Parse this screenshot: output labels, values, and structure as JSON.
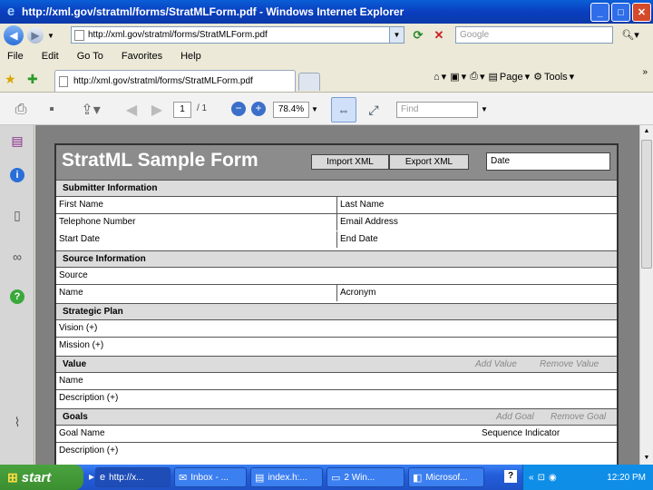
{
  "window": {
    "title": "http://xml.gov/stratml/forms/StratMLForm.pdf - Windows Internet Explorer",
    "minimize": "_",
    "maximize": "□",
    "close": "✕"
  },
  "address": {
    "url": "http://xml.gov/stratml/forms/StratMLForm.pdf",
    "search_placeholder": "Google"
  },
  "menu": [
    "File",
    "Edit",
    "Go To",
    "Favorites",
    "Help"
  ],
  "tabs": {
    "active_label": "http://xml.gov/stratml/forms/StratMLForm.pdf"
  },
  "commands": {
    "page": "Page",
    "tools": "Tools",
    "more": "»"
  },
  "pdf_toolbar": {
    "page_number": "1",
    "page_of": "/ 1",
    "zoom": "78.4%",
    "find_placeholder": "Find"
  },
  "form": {
    "title": "StratML Sample Form",
    "import_label": "Import XML",
    "export_label": "Export XML",
    "date_label": "Date",
    "submitter": {
      "heading": "Submitter Information",
      "first_name": "First Name",
      "last_name": "Last Name",
      "telephone": "Telephone Number",
      "email": "Email Address",
      "start_date": "Start Date",
      "end_date": "End Date"
    },
    "source": {
      "heading": "Source Information",
      "source": "Source",
      "name": "Name",
      "acronym": "Acronym"
    },
    "plan": {
      "heading": "Strategic Plan",
      "vision": "Vision (+)",
      "mission": "Mission (+)"
    },
    "value": {
      "heading": "Value",
      "add": "Add Value",
      "remove": "Remove Value",
      "name": "Name",
      "description": "Description (+)"
    },
    "goals": {
      "heading": "Goals",
      "add": "Add Goal",
      "remove": "Remove Goal",
      "goal_name": "Goal Name",
      "sequence": "Sequence Indicator",
      "description": "Description (+)"
    }
  },
  "taskbar": {
    "start": "start",
    "tasks": [
      "http://x...",
      "Inbox - ...",
      "index.h:...",
      "2 Win...",
      "Microsof..."
    ],
    "clock": "12:20 PM"
  }
}
